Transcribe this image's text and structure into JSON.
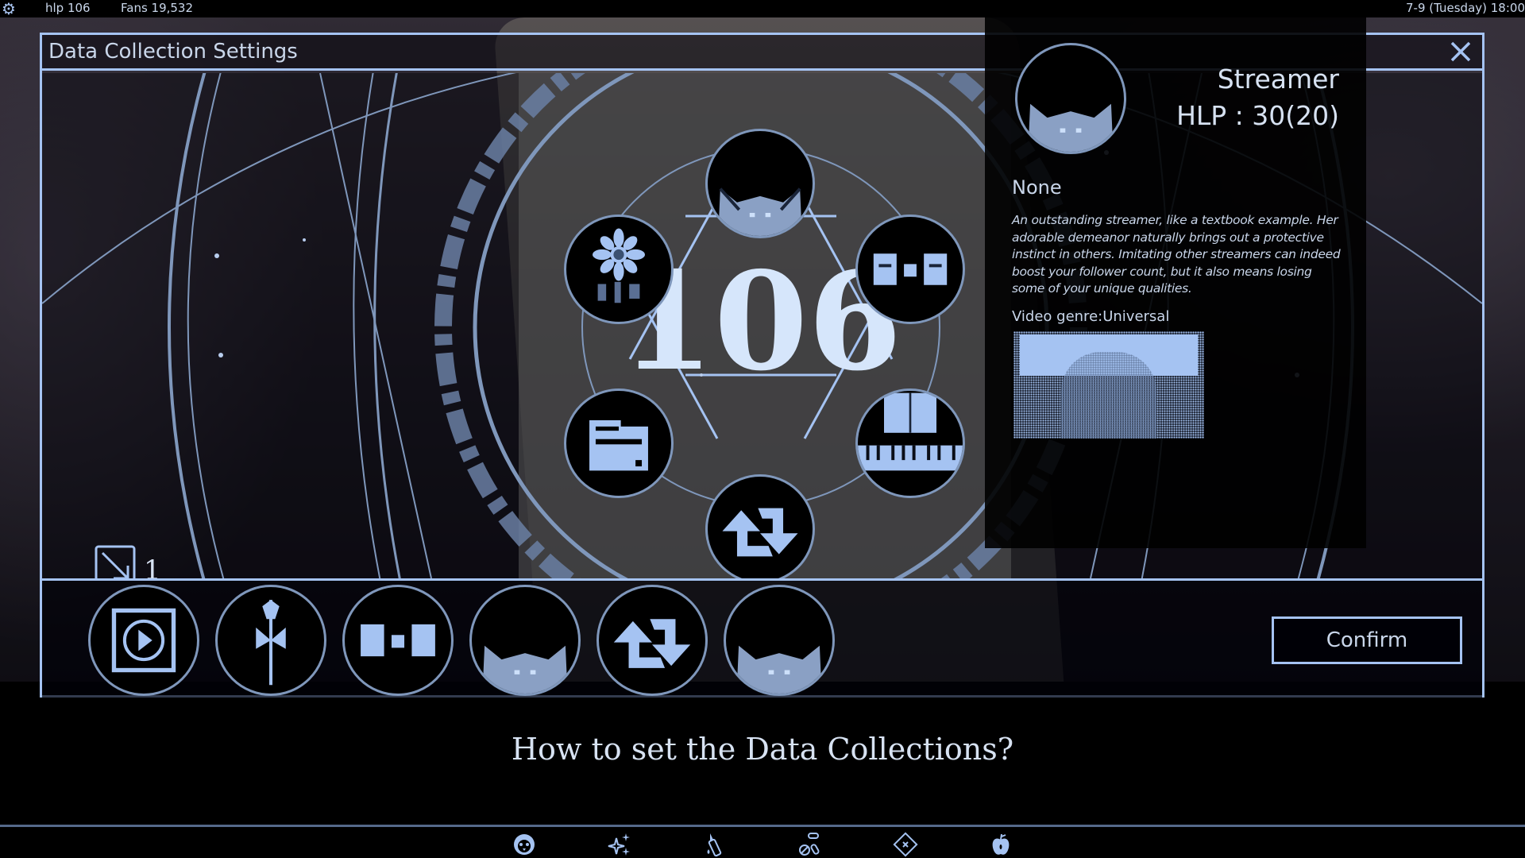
{
  "topbar": {
    "hlp": "hlp 106",
    "fans": "Fans 19,532",
    "datetime": "7-9 (Tuesday) 18:00"
  },
  "dialog": {
    "title": "Data Collection Settings",
    "center_value": "106",
    "ring_text": "106",
    "count": "1",
    "nodes": [
      {
        "position": "top",
        "icon": "cat-ears-avatar-icon"
      },
      {
        "position": "upper-right",
        "icon": "masks-icon"
      },
      {
        "position": "lower-right",
        "icon": "piano-icon"
      },
      {
        "position": "bottom",
        "icon": "repost-arrows-icon"
      },
      {
        "position": "lower-left",
        "icon": "folder-icon"
      },
      {
        "position": "upper-left",
        "icon": "flower-icon"
      }
    ],
    "slots": [
      {
        "icon": "play-button-icon"
      },
      {
        "icon": "scepter-icon"
      },
      {
        "icon": "masks-icon"
      },
      {
        "icon": "cat-ears-avatar-icon"
      },
      {
        "icon": "repost-arrows-icon"
      },
      {
        "icon": "cat-ears-avatar-icon"
      }
    ],
    "confirm_label": "Confirm"
  },
  "info": {
    "name": "Streamer",
    "hlp": "HLP : 30(20)",
    "tag": "None",
    "description": "An outstanding streamer, like a textbook example. Her adorable demeanor naturally brings out a protective instinct in others. Imitating other streamers can indeed boost your follower count, but it also means losing some of your unique qualities.",
    "genre": "Video genre:Universal"
  },
  "question": "How to set the Data Collections?",
  "bottom_nav": [
    {
      "icon": "penguin-icon"
    },
    {
      "icon": "sparkles-icon"
    },
    {
      "icon": "box-cutter-icon"
    },
    {
      "icon": "pills-icon"
    },
    {
      "icon": "ticket-icon"
    },
    {
      "icon": "apple-icon"
    }
  ],
  "colors": {
    "accent": "#a5c3f2",
    "ring": "#7f97bb",
    "text": "#c9d6ea"
  }
}
